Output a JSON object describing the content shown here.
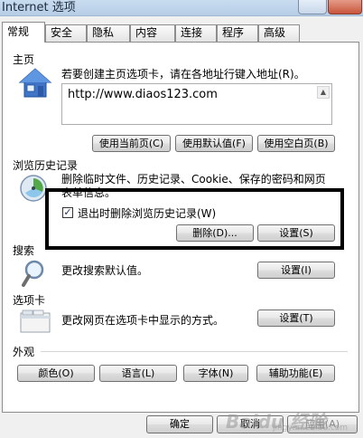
{
  "window": {
    "title": "Internet 选项"
  },
  "tabs": [
    {
      "label": "常规"
    },
    {
      "label": "安全"
    },
    {
      "label": "隐私"
    },
    {
      "label": "内容"
    },
    {
      "label": "连接"
    },
    {
      "label": "程序"
    },
    {
      "label": "高级"
    }
  ],
  "homepage": {
    "section": "主页",
    "description": "若要创建主页选项卡，请在各地址行键入地址(R)。",
    "url": "http://www.diaos123.com",
    "btn_current": "使用当前页(C)",
    "btn_default": "使用默认值(F)",
    "btn_blank": "使用空白页(B)"
  },
  "history": {
    "section": "浏览历史记录",
    "description": "删除临时文件、历史记录、Cookie、保存的密码和网页表单信息。",
    "checkbox_label": "退出时删除浏览历史记录(W)",
    "checkbox_checked": true,
    "checkbox_mark": "✓",
    "btn_delete": "删除(D)...",
    "btn_settings": "设置(S)"
  },
  "search": {
    "section": "搜索",
    "description": "更改搜索默认值。",
    "btn_settings": "设置(I)"
  },
  "tabs_section": {
    "section": "选项卡",
    "description": "更改网页在选项卡中显示的方式。",
    "btn_settings": "设置(T)"
  },
  "appearance": {
    "section": "外观",
    "btn_colors": "颜色(O)",
    "btn_languages": "语言(L)",
    "btn_fonts": "字体(N)",
    "btn_accessibility": "辅助功能(E)"
  },
  "footer": {
    "btn_ok": "确定",
    "btn_cancel": "取消",
    "btn_apply": "应用(A)"
  },
  "watermark": {
    "brand": "Baidu 经验",
    "sub": "jingyan.baidu.com"
  }
}
